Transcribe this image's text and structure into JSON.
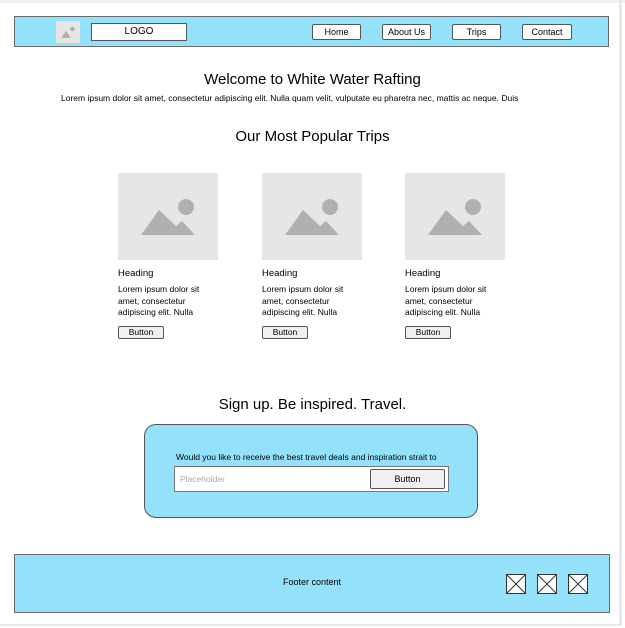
{
  "header": {
    "logo_text": "LOGO",
    "logo_image_icon": "image-icon",
    "nav": [
      {
        "label": "Home"
      },
      {
        "label": "About Us"
      },
      {
        "label": "Trips"
      },
      {
        "label": "Contact"
      }
    ]
  },
  "main": {
    "welcome_title": "Welcome to White Water Rafting",
    "intro_text": "Lorem ipsum dolor sit amet, consectetur adipiscing elit. Nulla quam velit, vulputate eu pharetra nec, mattis ac neque. Duis",
    "popular_title": "Our Most Popular Trips",
    "cards": [
      {
        "heading": "Heading",
        "text": "Lorem ipsum dolor sit amet, consectetur adipiscing elit. Nulla",
        "button": "Button",
        "image_icon": "image-icon"
      },
      {
        "heading": "Heading",
        "text": "Lorem ipsum dolor sit amet, consectetur adipiscing elit. Nulla",
        "button": "Button",
        "image_icon": "image-icon"
      },
      {
        "heading": "Heading",
        "text": "Lorem ipsum dolor sit amet, consectetur adipiscing elit. Nulla",
        "button": "Button",
        "image_icon": "image-icon"
      }
    ]
  },
  "signup": {
    "title": "Sign up. Be inspired. Travel.",
    "question": "Would you like to receive the best travel deals and inspiration strait to",
    "placeholder": "Placeholder",
    "button": "Button"
  },
  "footer": {
    "text": "Footer content",
    "icons": [
      "image-placeholder-icon",
      "image-placeholder-icon",
      "image-placeholder-icon"
    ]
  },
  "colors": {
    "accent": "#94e1fb",
    "placeholder_gray": "#e6e6e6",
    "icon_gray": "#b0b0b0"
  }
}
